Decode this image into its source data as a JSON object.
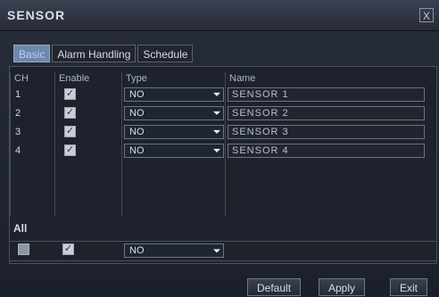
{
  "window": {
    "title": "SENSOR",
    "close_label": "X"
  },
  "tabs": [
    {
      "label": "Basic"
    },
    {
      "label": "Alarm Handling"
    },
    {
      "label": "Schedule"
    }
  ],
  "table": {
    "headers": [
      "CH",
      "Enable",
      "Type",
      "Name"
    ],
    "rows": [
      {
        "ch": "1",
        "enable": "✓",
        "type": "NO",
        "name": "SENSOR 1"
      },
      {
        "ch": "2",
        "enable": "✓",
        "type": "NO",
        "name": "SENSOR 2"
      },
      {
        "ch": "3",
        "enable": "✓",
        "type": "NO",
        "name": "SENSOR 3"
      },
      {
        "ch": "4",
        "enable": "✓",
        "type": "NO",
        "name": "SENSOR 4"
      }
    ]
  },
  "all": {
    "label": "All",
    "select_check": "",
    "enable_check": "✓",
    "type": "NO"
  },
  "buttons": {
    "default": "Default",
    "apply": "Apply",
    "exit": "Exit"
  }
}
